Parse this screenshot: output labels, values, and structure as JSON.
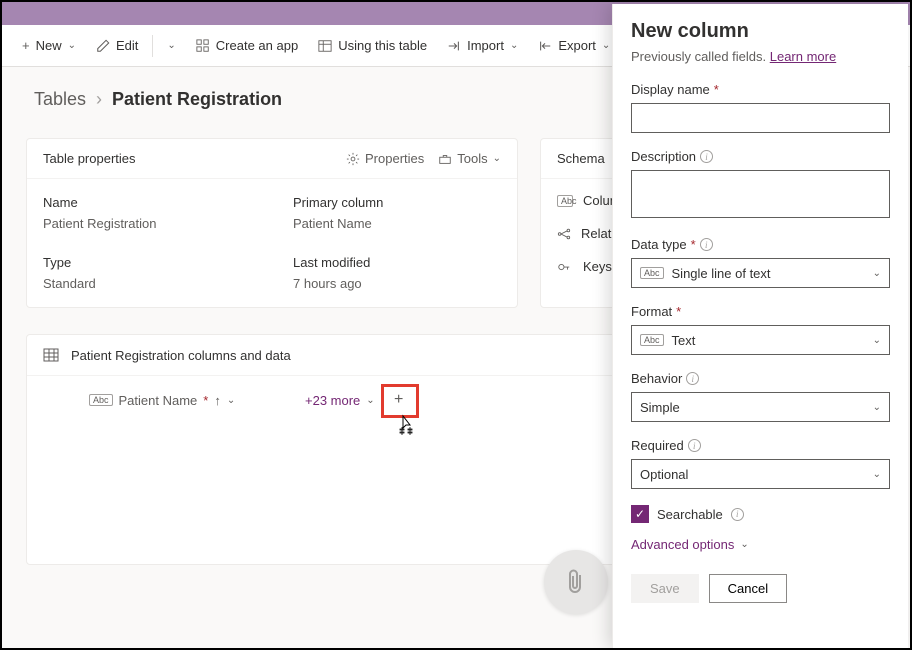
{
  "toolbar": {
    "new": "New",
    "edit": "Edit",
    "create_app": "Create an app",
    "using_table": "Using this table",
    "import": "Import",
    "export": "Export"
  },
  "breadcrumb": {
    "parent": "Tables",
    "current": "Patient Registration"
  },
  "props_card": {
    "title": "Table properties",
    "properties_action": "Properties",
    "tools_action": "Tools",
    "name_label": "Name",
    "name_value": "Patient Registration",
    "type_label": "Type",
    "type_value": "Standard",
    "primary_label": "Primary column",
    "primary_value": "Patient Name",
    "modified_label": "Last modified",
    "modified_value": "7 hours ago"
  },
  "schema_card": {
    "title": "Schema",
    "columns": "Column",
    "relationships": "Relation",
    "keys": "Keys"
  },
  "data_card": {
    "title": "Patient Registration columns and data",
    "column1": "Patient Name",
    "more": "+23 more"
  },
  "panel": {
    "title": "New column",
    "subtitle_prefix": "Previously called fields. ",
    "subtitle_link": "Learn more",
    "display_name_label": "Display name",
    "description_label": "Description",
    "datatype_label": "Data type",
    "datatype_value": "Single line of text",
    "format_label": "Format",
    "format_value": "Text",
    "behavior_label": "Behavior",
    "behavior_value": "Simple",
    "required_label": "Required",
    "required_value": "Optional",
    "searchable_label": "Searchable",
    "advanced": "Advanced options",
    "save": "Save",
    "cancel": "Cancel"
  }
}
